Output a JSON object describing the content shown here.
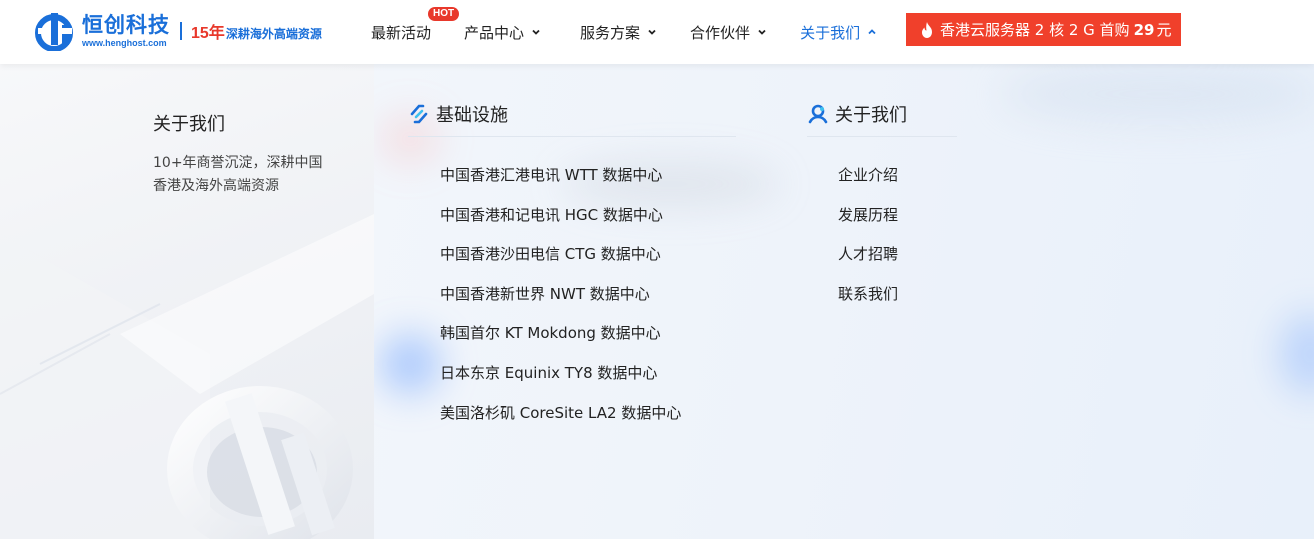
{
  "brand": {
    "name": "恒创科技",
    "domain": "www.henghost.com",
    "years": "15年",
    "slogan": "深耕海外高端资源"
  },
  "nav": {
    "items": [
      {
        "label": "最新活动",
        "has_dropdown": false
      },
      {
        "label": "产品中心",
        "has_dropdown": true,
        "badge": "HOT"
      },
      {
        "label": "服务方案",
        "has_dropdown": true
      },
      {
        "label": "合作伙伴",
        "has_dropdown": true
      },
      {
        "label": "关于我们",
        "has_dropdown": true,
        "active": true
      }
    ],
    "promo": {
      "text": "香港云服务器 2 核 2 G 首购",
      "price": "29",
      "unit": "元"
    }
  },
  "dropdown": {
    "intro": {
      "title": "关于我们",
      "description": "10+年商誉沉淀，深耕中国香港及海外高端资源"
    },
    "infrastructure": {
      "title": "基础设施",
      "icon": "infrastructure-icon",
      "links": [
        "中国香港汇港电讯 WTT 数据中心",
        "中国香港和记电讯 HGC 数据中心",
        "中国香港沙田电信 CTG 数据中心",
        "中国香港新世界 NWT 数据中心",
        "韩国首尔 KT Mokdong 数据中心",
        "日本东京 Equinix TY8 数据中心",
        "美国洛杉矶 CoreSite LA2 数据中心"
      ]
    },
    "about": {
      "title": "关于我们",
      "icon": "person-icon",
      "links": [
        "企业介绍",
        "发展历程",
        "人才招聘",
        "联系我们"
      ]
    }
  },
  "colors": {
    "brand_blue": "#1a6fd9",
    "hot_red": "#e8382b",
    "promo_bg": "#f0402b"
  }
}
